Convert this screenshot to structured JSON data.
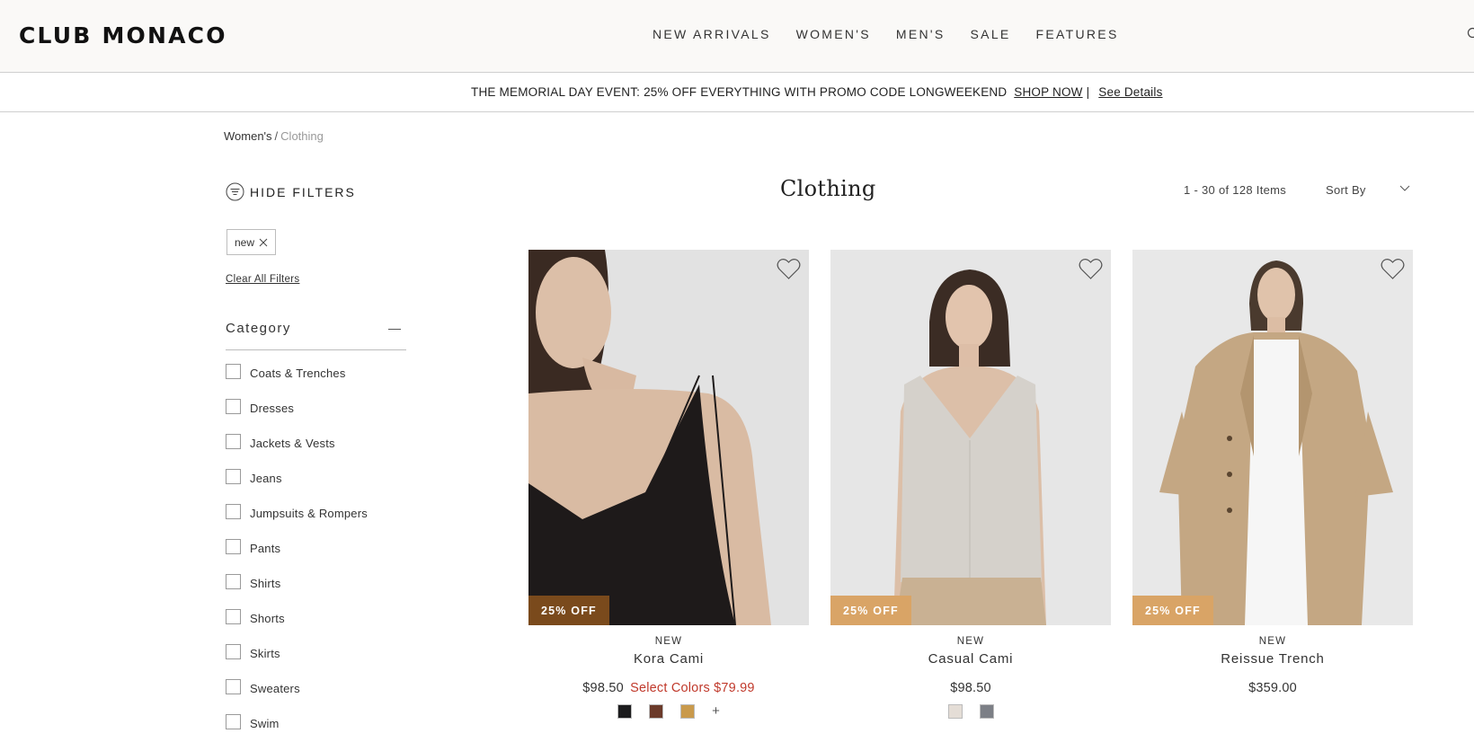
{
  "header": {
    "logo": "CLUB MONACO",
    "nav": [
      "NEW ARRIVALS",
      "WOMEN'S",
      "MEN'S",
      "SALE",
      "FEATURES"
    ]
  },
  "promo": {
    "text": "THE MEMORIAL DAY EVENT: 25% OFF EVERYTHING WITH PROMO CODE LONGWEEKEND",
    "shop_now": "SHOP NOW",
    "separator": "|",
    "details": "See Details"
  },
  "breadcrumb": {
    "root": "Women's",
    "separator": "/",
    "current": "Clothing"
  },
  "filters": {
    "hide_label": "HIDE FILTERS",
    "active_chip": "new",
    "clear_all": "Clear All Filters",
    "category_title": "Category",
    "categories": [
      "Coats & Trenches",
      "Dresses",
      "Jackets & Vests",
      "Jeans",
      "Jumpsuits & Rompers",
      "Pants",
      "Shirts",
      "Shorts",
      "Skirts",
      "Sweaters",
      "Swim"
    ]
  },
  "listing": {
    "title": "Clothing",
    "count": "1 - 30 of 128 Items",
    "sort_label": "Sort By"
  },
  "products": [
    {
      "badge": "25% OFF",
      "badge_color": "#7a4a1c",
      "tag": "NEW",
      "name": "Kora Cami",
      "price": "$98.50",
      "sale_text": "Select Colors $79.99",
      "swatches": [
        "#1c1c1e",
        "#6b3a2a",
        "#c99a4c"
      ],
      "more_swatches": "+"
    },
    {
      "badge": "25% OFF",
      "badge_color": "#d9a466",
      "tag": "NEW",
      "name": "Casual Cami",
      "price": "$98.50",
      "sale_text": "",
      "swatches": [
        "#e4ddd6",
        "#7c7f86"
      ],
      "more_swatches": ""
    },
    {
      "badge": "25% OFF",
      "badge_color": "#d9a466",
      "tag": "NEW",
      "name": "Reissue Trench",
      "price": "$359.00",
      "sale_text": "",
      "swatches": [],
      "more_swatches": ""
    }
  ],
  "colors": {
    "header_bg": "#faf9f7",
    "sale_red": "#c0392b"
  }
}
